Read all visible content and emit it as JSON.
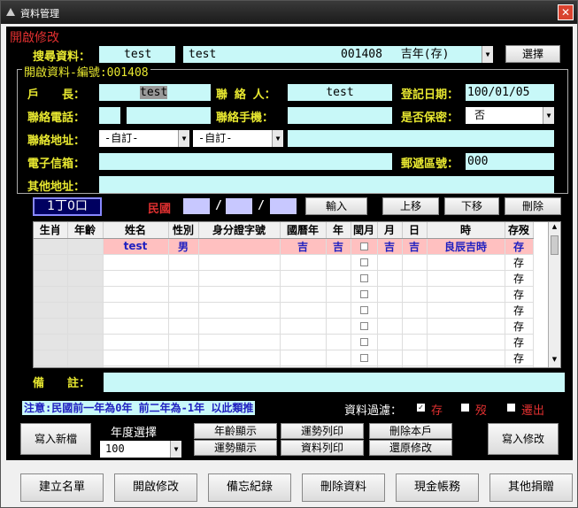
{
  "window": {
    "title": "資料管理",
    "close": "✕"
  },
  "mode_title": "開啟修改",
  "search": {
    "label": "搜尋資料：",
    "field1": "test",
    "field2": "test",
    "combo": "001408　 吉年(存)",
    "button": "選擇"
  },
  "record": {
    "legend": "開啟資料-編號:001408",
    "householder_label": "戶　　長：",
    "householder": "test",
    "contact_label": "聯 絡 人：",
    "contact": "test",
    "reg_date_label": "登記日期：",
    "reg_date": "100/01/05",
    "phone_label": "聯絡電話：",
    "phone_area": "",
    "phone": "",
    "mobile_label": "聯絡手機：",
    "mobile": "",
    "confidential_label": "是否保密：",
    "confidential": "否",
    "address_label": "聯絡地址：",
    "city": "-自訂-",
    "district": "-自訂-",
    "address": "",
    "email_label": "電子信箱：",
    "email": "",
    "zip_label": "郵遞區號：",
    "zip": "000",
    "other_addr_label": "其他地址：",
    "other_addr": ""
  },
  "entry": {
    "count": "1丁0口",
    "roc_label": "民國",
    "slash1": "/",
    "slash2": "/",
    "input_btn": "輸入",
    "up_btn": "上移",
    "down_btn": "下移",
    "delete_btn": "刪除"
  },
  "grid": {
    "headers": [
      "生肖",
      "年齡",
      "姓名",
      "性別",
      "身分證字號",
      "國曆年",
      "年",
      "閏月",
      "月",
      "日",
      "時",
      "存歿"
    ],
    "rows": [
      [
        "",
        "",
        "test",
        "男",
        "",
        "吉",
        "吉",
        "",
        "吉",
        "吉",
        "良辰吉時",
        "存"
      ],
      [
        "",
        "",
        "",
        "",
        "",
        "",
        "",
        "",
        "",
        "",
        "",
        "存"
      ],
      [
        "",
        "",
        "",
        "",
        "",
        "",
        "",
        "",
        "",
        "",
        "",
        "存"
      ],
      [
        "",
        "",
        "",
        "",
        "",
        "",
        "",
        "",
        "",
        "",
        "",
        "存"
      ],
      [
        "",
        "",
        "",
        "",
        "",
        "",
        "",
        "",
        "",
        "",
        "",
        "存"
      ],
      [
        "",
        "",
        "",
        "",
        "",
        "",
        "",
        "",
        "",
        "",
        "",
        "存"
      ],
      [
        "",
        "",
        "",
        "",
        "",
        "",
        "",
        "",
        "",
        "",
        "",
        "存"
      ],
      [
        "",
        "",
        "",
        "",
        "",
        "",
        "",
        "",
        "",
        "",
        "",
        "存"
      ],
      [
        "",
        "",
        "",
        "",
        "",
        "",
        "",
        "",
        "",
        "",
        "",
        "存"
      ]
    ]
  },
  "notes": {
    "label": "備　　註：",
    "value": ""
  },
  "footer": {
    "hint": "注意:民國前一年為0年 前二年為-1年 以此類推",
    "filter_label": "資料過濾：",
    "filter_alive": "存",
    "filter_dead": "歿",
    "filter_moved": "遷出"
  },
  "actions": {
    "new_write": "寫入新檔",
    "year_label": "年度選擇",
    "year": "100",
    "age_show": "年齡顯示",
    "fortune_show": "運勢顯示",
    "fortune_print": "運勢列印",
    "data_print": "資料列印",
    "delete_household": "刪除本戶",
    "restore_edit": "還原修改",
    "write_edit": "寫入修改"
  },
  "bottom": {
    "build_list": "建立名單",
    "open_edit": "開啟修改",
    "memo_log": "備忘紀錄",
    "delete_data": "刪除資料",
    "cash_account": "現金帳務",
    "other_donation": "其他捐贈"
  },
  "colors": {
    "accent_red": "#e03030",
    "label_yellow": "#e8e830",
    "field_cyan": "#c8f8f8",
    "highlight_row": "#ffc0c0"
  }
}
